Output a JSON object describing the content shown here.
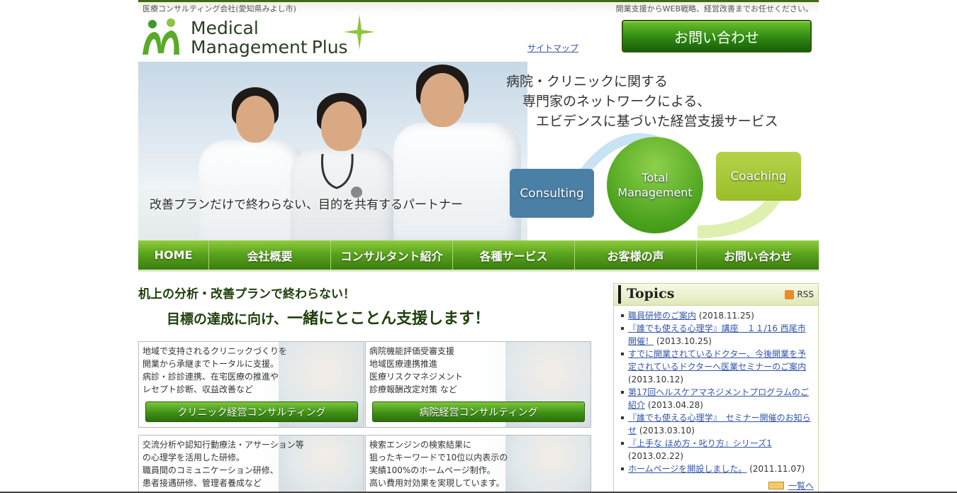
{
  "subheader": {
    "left": "医療コンサルティング会社(愛知県みよし市)",
    "right": "開業支援からWEB戦略、経営改善までお任せください。"
  },
  "logo": {
    "line1": "Medical",
    "line2": "Management",
    "plus": "Plus"
  },
  "header": {
    "sitemap": "サイトマップ",
    "contact_button": "お問い合わせ"
  },
  "hero": {
    "tagline1": "病院・クリニックに関する",
    "tagline2": "専門家のネットワークによる、",
    "tagline3": "エビデンスに基づいた経営支援サービス",
    "caption": "改善プランだけで終わらない、目的を共有するパートナー",
    "consulting": "Consulting",
    "total1": "Total",
    "total2": "Management",
    "coaching": "Coaching"
  },
  "nav": [
    {
      "label": "HOME"
    },
    {
      "label": "会社概要"
    },
    {
      "label": "コンサルタント紹介"
    },
    {
      "label": "各種サービス"
    },
    {
      "label": "お客様の声"
    },
    {
      "label": "お問い合わせ"
    }
  ],
  "lead": {
    "line1": "机上の分析・改善プランで終わらない！",
    "line2a": "目標の達成に向け、",
    "line2b": "一緒にとことん支援します！"
  },
  "cards": [
    {
      "lines": [
        "地域で支持されるクリニックづくりを",
        "開業から承継までトータルに支援。",
        "病診・診診連携、在宅医療の推進や",
        "レセプト診断、収益改善など"
      ],
      "button": "クリニック経営コンサルティング"
    },
    {
      "lines": [
        "病院機能評価受審支援",
        "地域医療連携推進",
        "医療リスクマネジメント",
        "診療報酬改定対策 など"
      ],
      "button": "病院経営コンサルティング"
    },
    {
      "lines": [
        "交流分析や認知行動療法・アサーション等",
        "の心理学を活用した研修。",
        "職員間のコミュニケーション研修、",
        "患者接遇研修、管理者養成など"
      ],
      "button": ""
    },
    {
      "lines": [
        "検索エンジンの検索結果に",
        "狙ったキーワードで10位以内表示の",
        "実績100%のホームページ制作。",
        "高い費用対効果を実現しています。"
      ],
      "button": ""
    }
  ],
  "topics": {
    "title": "Topics",
    "rss": "RSS",
    "items": [
      {
        "link": "職員研修のご案内",
        "date": "(2018.11.25)"
      },
      {
        "link": "『誰でも使える心理学』講座　１１/16 西尾市開催！",
        "date": "(2013.10.25)"
      },
      {
        "link": "すでに開業されているドクター、今後開業を予定されているドクターへ医業セミナーのご案内",
        "date": "(2013.10.12)"
      },
      {
        "link": "第17回ヘルスケアマネジメントプログラムのご紹介",
        "date": "(2013.04.28)"
      },
      {
        "link": "『誰でも使える心理学』　セミナー開催のお知らせ",
        "date": "(2013.03.10)"
      },
      {
        "link": "『上手な ほめ方・叱り方』シリーズ1",
        "date": "(2013.02.22)"
      },
      {
        "link": "ホームページを開設しました。",
        "date": "(2011.11.07)"
      }
    ],
    "more": "一覧へ"
  }
}
